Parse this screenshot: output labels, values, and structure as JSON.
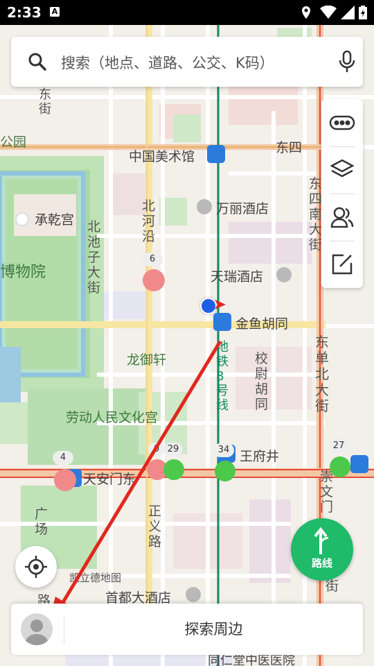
{
  "status_bar": {
    "time": "2:33",
    "notification_icon": "A"
  },
  "search": {
    "placeholder": "搜索（地点、道路、公交、K码）"
  },
  "map": {
    "labels": {
      "park": "公园",
      "east_street": "东街",
      "meishuguan": "中国美术馆",
      "dongsi": "东四",
      "wanli": "万丽酒店",
      "chengqian": "承乾宫",
      "museum": "博物院",
      "beiheyan": "北河沿",
      "beichizi": "北池子大街",
      "dongsinan": "东四南大街",
      "tianrui": "天瑞酒店",
      "jinyu": "金鱼胡同",
      "longyu": "龙御轩",
      "metro8": "地铁8号线",
      "xiaowei": "校尉胡同",
      "dongdan": "东单北大街",
      "laodong": "劳动人民文化宫",
      "wangfujing": "王府井",
      "tiananmen": "天安门东",
      "guangchang": "广场",
      "zhengyi": "正义路",
      "chongwen": "崇文门",
      "kailide": "凯立德地图",
      "shoudu": "首都大酒店",
      "hospital": "同仁堂中医医院",
      "lu": "路",
      "jie": "街"
    },
    "traffic_counts": {
      "a": "6",
      "b": "4",
      "c": "0",
      "d": "29",
      "e": "34",
      "f": "27"
    }
  },
  "route_button": {
    "label": "路线"
  },
  "bottom_bar": {
    "explore_label": "探索周边"
  },
  "colors": {
    "accent_green": "#1fba6a",
    "arrow_red": "#e0281f",
    "location_blue": "#1f5fe6"
  }
}
